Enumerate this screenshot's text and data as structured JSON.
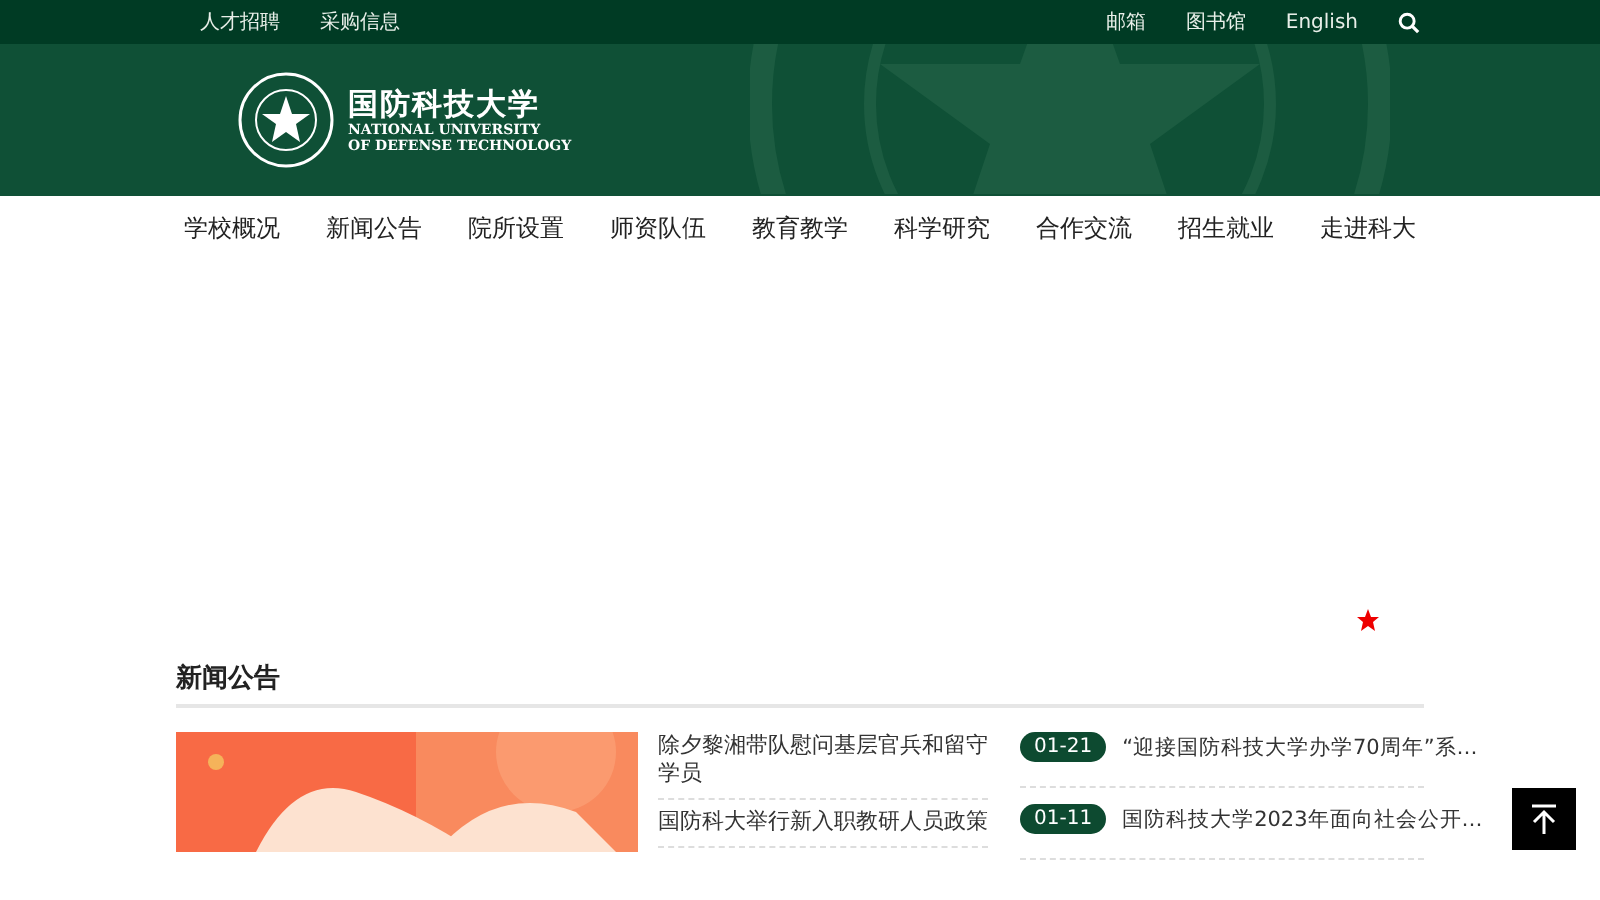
{
  "top_bar": {
    "left_links": [
      "人才招聘",
      "采购信息"
    ],
    "right_links": [
      "邮箱",
      "图书馆",
      "English"
    ]
  },
  "header": {
    "logo_cn": "国防科技大学",
    "logo_en": [
      "NATIONAL UNIVERSITY",
      "OF DEFENSE TECHNOLOGY"
    ]
  },
  "nav": [
    "学校概况",
    "新闻公告",
    "院所设置",
    "师资队伍",
    "教育教学",
    "科学研究",
    "合作交流",
    "招生就业",
    "走进科大"
  ],
  "news": {
    "title": "新闻公告",
    "feature": {
      "kind": "picture"
    },
    "headlines": [
      "除夕黎湘带队慰问基层官兵和留守学员",
      "国防科大举行新入职教研人员政策"
    ],
    "dated": [
      {
        "date": "01-21",
        "title": "“迎接国防科技大学办学70周年”系…"
      },
      {
        "date": "01-11",
        "title": "国防科技大学2023年面向社会公开…"
      }
    ]
  }
}
